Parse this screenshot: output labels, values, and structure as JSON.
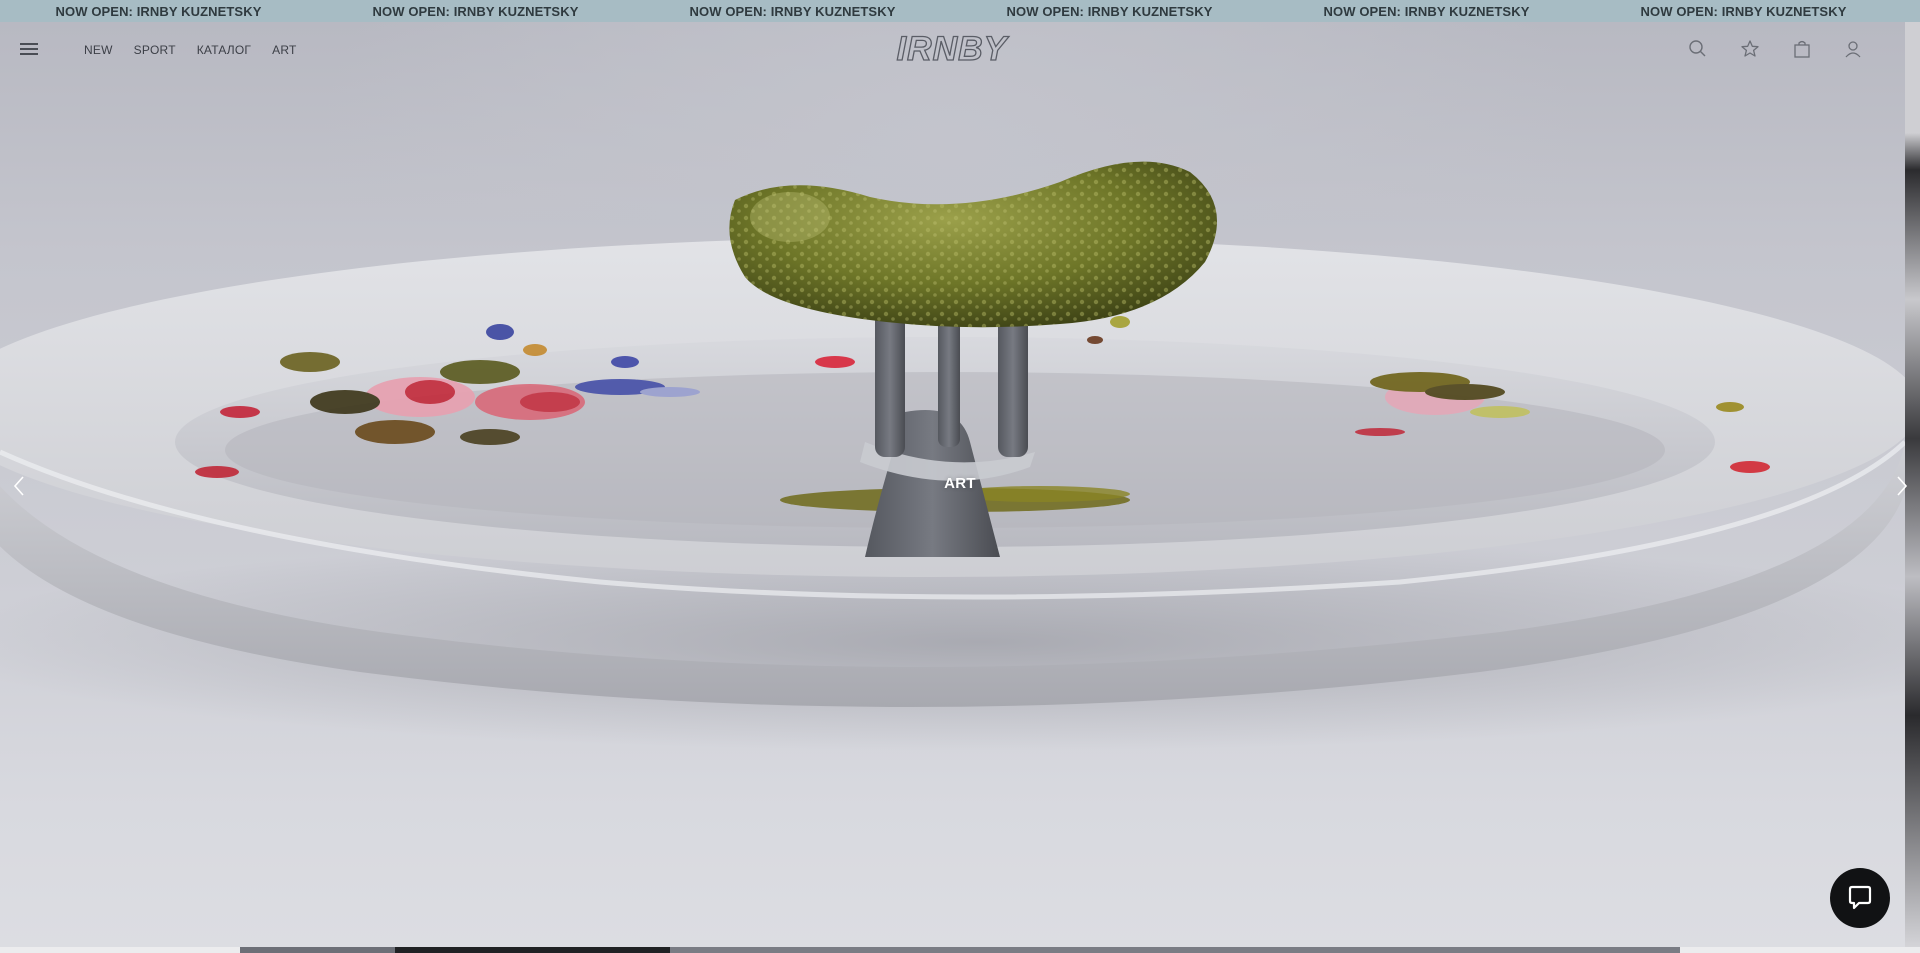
{
  "announcement": {
    "items": [
      "NOW OPEN: IRNBY KUZNETSKY",
      "NOW OPEN: IRNBY KUZNETSKY",
      "NOW OPEN: IRNBY KUZNETSKY",
      "NOW OPEN: IRNBY KUZNETSKY",
      "NOW OPEN: IRNBY KUZNETSKY",
      "NOW OPEN: IRNBY KUZNETSKY"
    ],
    "background": "#a7bcc4"
  },
  "header": {
    "logo_text": "IRNBY",
    "nav": [
      "NEW",
      "SPORT",
      "КАТАЛОГ",
      "ART"
    ],
    "icons": [
      "search-icon",
      "favorites-star-icon",
      "bag-icon",
      "user-icon"
    ]
  },
  "hero": {
    "slide_caption": "ART"
  },
  "colors": {
    "text_dark": "#3c3f47",
    "chat_button": "#111214"
  }
}
